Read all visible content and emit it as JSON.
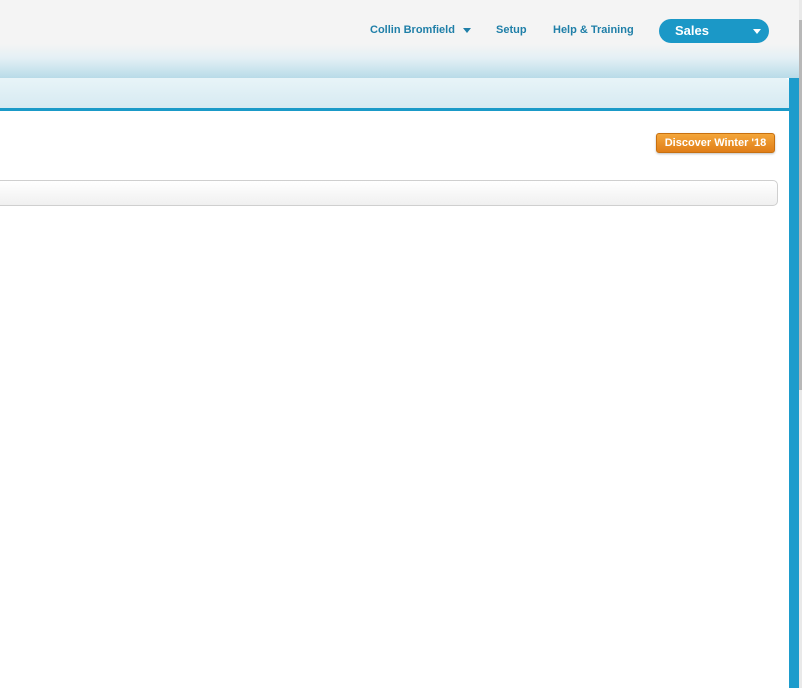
{
  "header": {
    "user_name": "Collin Bromfield",
    "setup_label": "Setup",
    "help_label": "Help & Training",
    "app_name": "Sales"
  },
  "content": {
    "release_button_label": "Discover Winter '18"
  },
  "colors": {
    "accent": "#1b98c7",
    "link": "#1f7fa8",
    "release_button": "#e8901f"
  },
  "icons": {
    "user_menu_caret": "chevron-down-icon",
    "app_switcher_caret": "chevron-down-icon"
  }
}
